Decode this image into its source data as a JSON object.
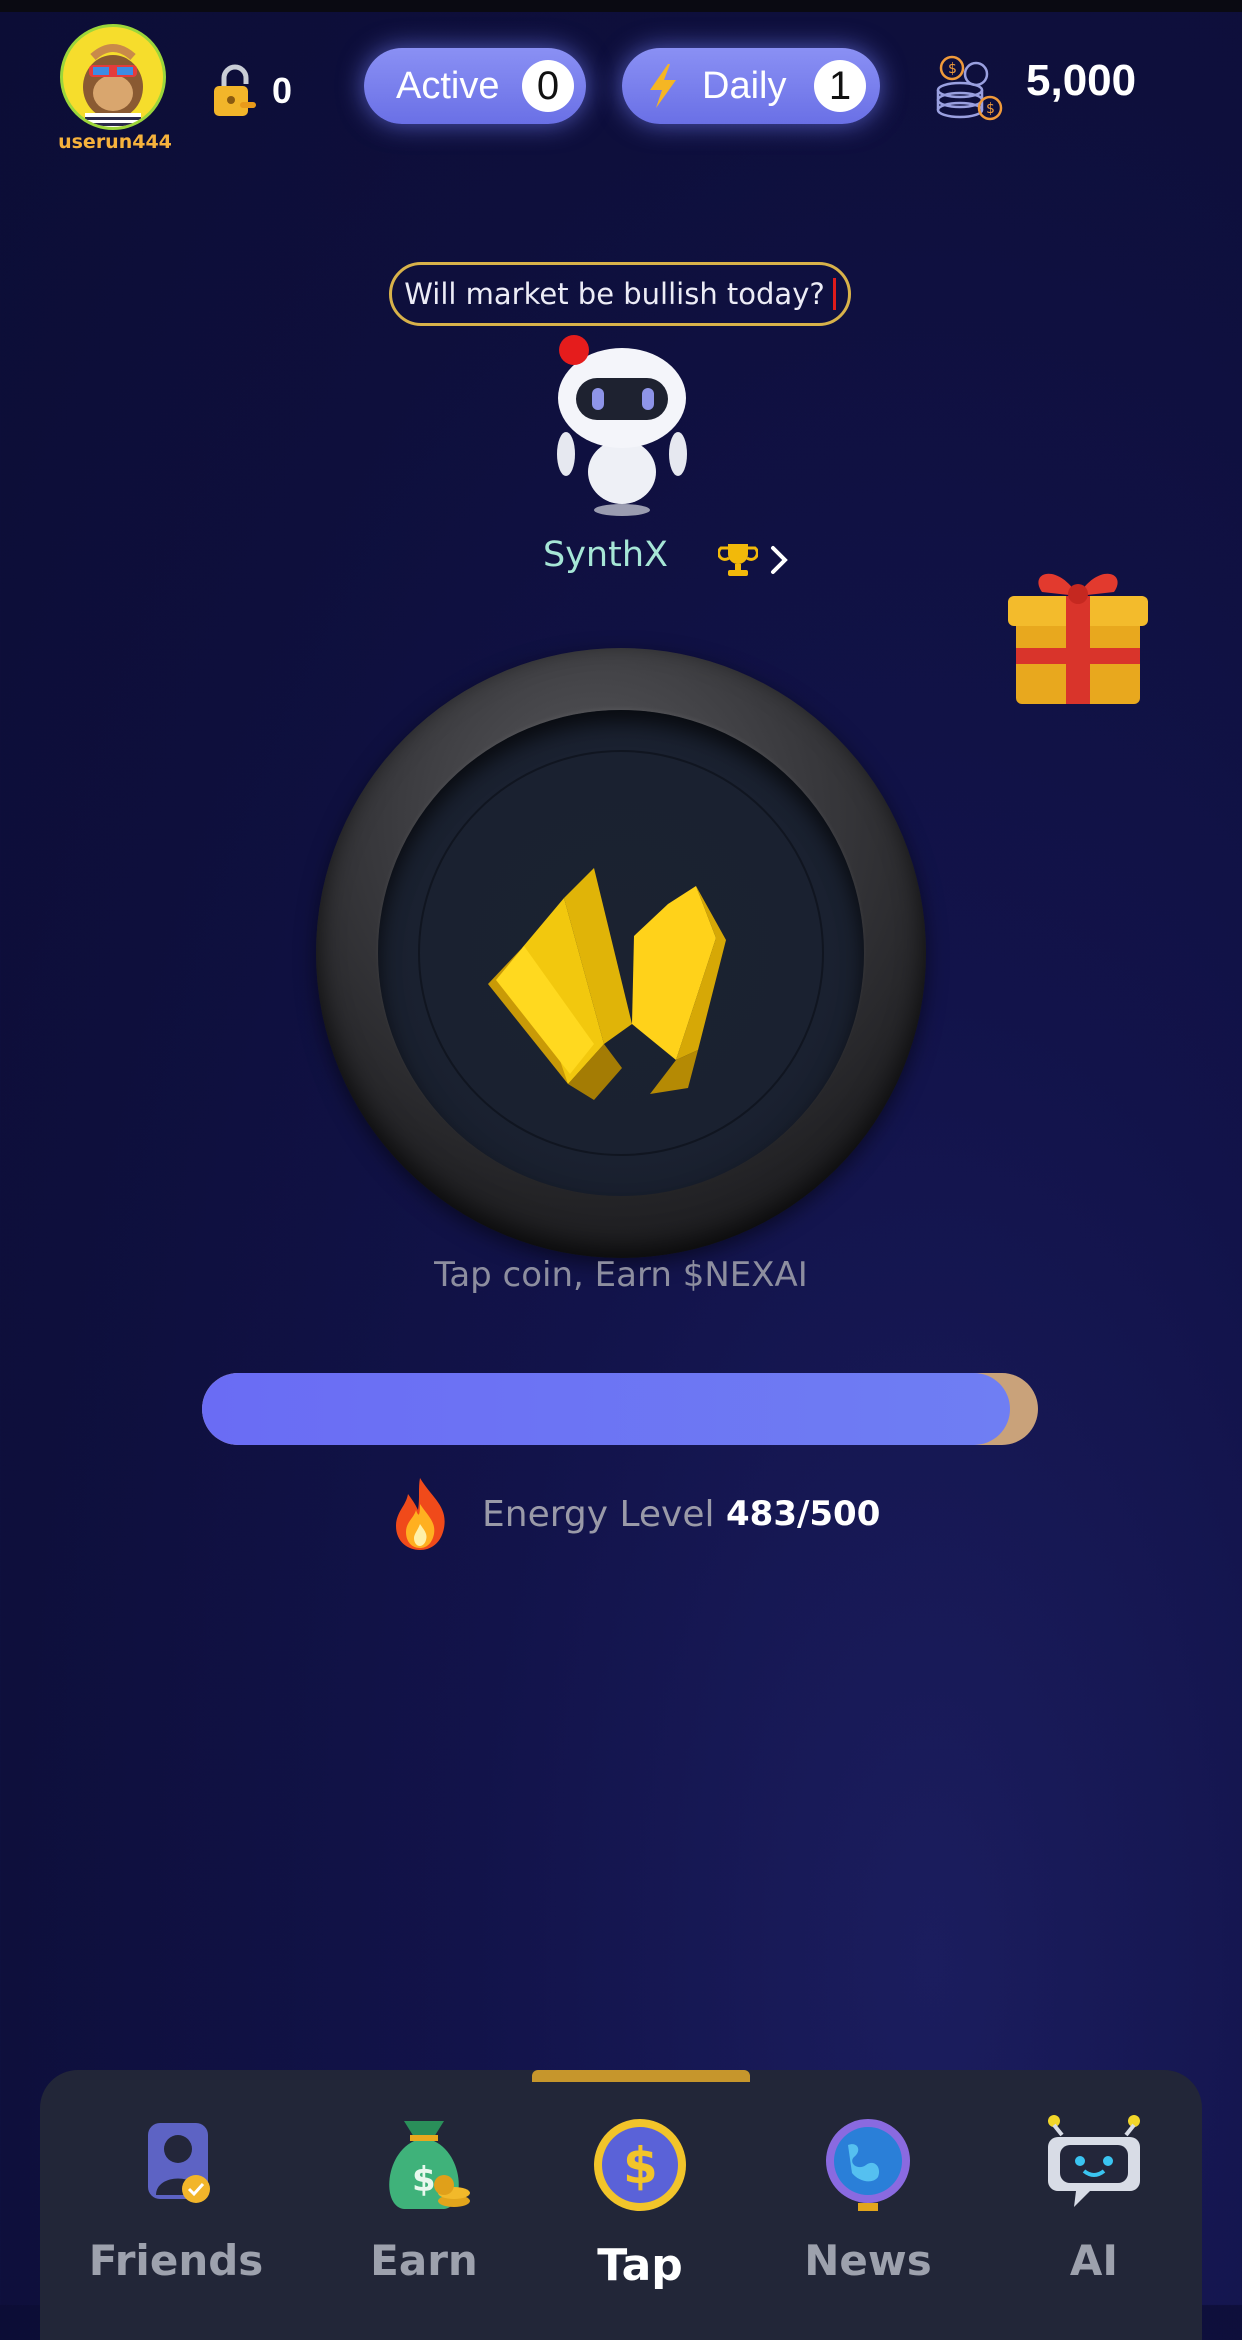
{
  "header": {
    "username": "userun444",
    "lock_count": "0",
    "active_label": "Active",
    "active_count": "0",
    "daily_label": "Daily",
    "daily_count": "1",
    "balance": "5,000"
  },
  "bot": {
    "prompt": "Will market be bullish today?",
    "name": "SynthX"
  },
  "coin": {
    "caption": "Tap coin, Earn $NEXAI"
  },
  "energy": {
    "label": "Energy Level",
    "value": "483/500",
    "fraction": 0.966
  },
  "nav": {
    "items": [
      {
        "label": "Friends",
        "icon": "friends-icon"
      },
      {
        "label": "Earn",
        "icon": "money-bag-icon"
      },
      {
        "label": "Tap",
        "icon": "dollar-coin-icon",
        "active": true
      },
      {
        "label": "News",
        "icon": "globe-icon"
      },
      {
        "label": "AI",
        "icon": "chat-bot-icon"
      }
    ]
  },
  "colors": {
    "accent": "#6a6cf4",
    "gold": "#d8b24a",
    "background": "#0e0f3c"
  }
}
